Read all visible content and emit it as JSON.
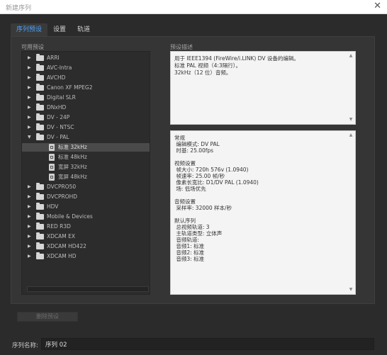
{
  "window": {
    "title": "新建序列"
  },
  "tabs": [
    {
      "label": "序列预设",
      "active": true
    },
    {
      "label": "设置",
      "active": false
    },
    {
      "label": "轨道",
      "active": false
    }
  ],
  "available_presets": {
    "label": "可用预设",
    "items": [
      {
        "label": "ARRI",
        "type": "folder",
        "expanded": false,
        "depth": 0
      },
      {
        "label": "AVC-Intra",
        "type": "folder",
        "expanded": false,
        "depth": 0
      },
      {
        "label": "AVCHD",
        "type": "folder",
        "expanded": false,
        "depth": 0
      },
      {
        "label": "Canon XF MPEG2",
        "type": "folder",
        "expanded": false,
        "depth": 0
      },
      {
        "label": "Digital SLR",
        "type": "folder",
        "expanded": false,
        "depth": 0
      },
      {
        "label": "DNxHD",
        "type": "folder",
        "expanded": false,
        "depth": 0
      },
      {
        "label": "DV - 24P",
        "type": "folder",
        "expanded": false,
        "depth": 0
      },
      {
        "label": "DV - NTSC",
        "type": "folder",
        "expanded": false,
        "depth": 0
      },
      {
        "label": "DV - PAL",
        "type": "folder",
        "expanded": true,
        "depth": 0
      },
      {
        "label": "标准 32kHz",
        "type": "preset",
        "selected": true,
        "depth": 1
      },
      {
        "label": "标准 48kHz",
        "type": "preset",
        "depth": 1
      },
      {
        "label": "宽屏 32kHz",
        "type": "preset",
        "depth": 1
      },
      {
        "label": "宽屏 48kHz",
        "type": "preset",
        "depth": 1
      },
      {
        "label": "DVCPRO50",
        "type": "folder",
        "expanded": false,
        "depth": 0
      },
      {
        "label": "DVCPROHD",
        "type": "folder",
        "expanded": false,
        "depth": 0
      },
      {
        "label": "HDV",
        "type": "folder",
        "expanded": false,
        "depth": 0
      },
      {
        "label": "Mobile & Devices",
        "type": "folder",
        "expanded": false,
        "depth": 0
      },
      {
        "label": "RED R3D",
        "type": "folder",
        "expanded": false,
        "depth": 0
      },
      {
        "label": "XDCAM EX",
        "type": "folder",
        "expanded": false,
        "depth": 0
      },
      {
        "label": "XDCAM HD422",
        "type": "folder",
        "expanded": false,
        "depth": 0
      },
      {
        "label": "XDCAM HD",
        "type": "folder",
        "expanded": false,
        "depth": 0
      }
    ]
  },
  "preset_description": {
    "label": "预设描述",
    "text": "用于 IEEE1394 (FireWire/i.LINK) DV 设备的编辑。\n标准 PAL 视频（4:3隔行）。\n32kHz（12 位）音频。"
  },
  "preset_details": {
    "text": "常规\n 编辑模式: DV PAL\n 时基: 25.00fps\n\n视频设置\n 帧大小: 720h 576v (1.0940)\n 帧速率: 25.00 帧/秒\n 像素长宽比: D1/DV PAL (1.0940)\n 场: 低场优先\n\n音频设置\n 采样率: 32000 样本/秒\n\n默认序列\n 总视频轨道: 3\n 主轨道类型: 立体声\n 音频轨道:\n 音频1: 标准\n 音频2: 标准\n 音频3: 标准"
  },
  "buttons": {
    "delete_preset": "删除预设"
  },
  "sequence_name": {
    "label": "序列名称:",
    "value": "序列 02"
  },
  "icons": {
    "close": "close-icon",
    "folder": "folder-icon",
    "preset": "preset-file-icon",
    "expand": "chevron-right-icon",
    "collapse": "chevron-down-icon"
  }
}
